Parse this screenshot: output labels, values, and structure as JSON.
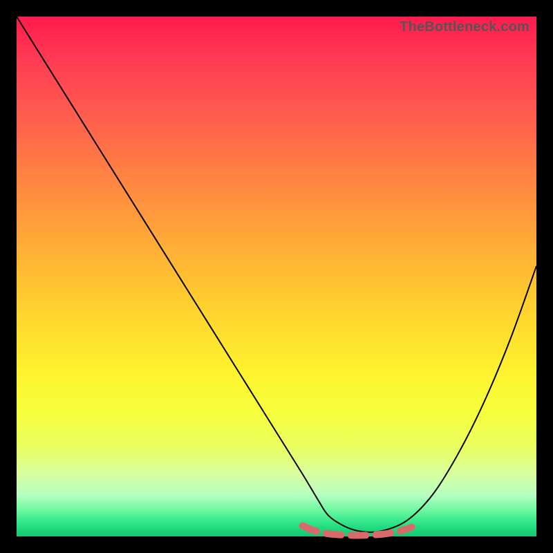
{
  "watermark": "TheBottleneck.com",
  "colors": {
    "background": "#000000",
    "curve": "#000000",
    "dash": "#d86a6a"
  },
  "chart_data": {
    "type": "line",
    "title": "",
    "xlabel": "",
    "ylabel": "",
    "xlim": [
      0,
      100
    ],
    "ylim": [
      0,
      100
    ],
    "grid": false,
    "series": [
      {
        "name": "bottleneck-curve",
        "x": [
          0,
          5,
          10,
          15,
          20,
          25,
          30,
          35,
          40,
          45,
          50,
          55,
          58,
          60,
          63,
          66,
          70,
          75,
          80,
          85,
          90,
          95,
          100
        ],
        "y": [
          100,
          92,
          84,
          76,
          68,
          60,
          52,
          44,
          36,
          28,
          20,
          12,
          7,
          4,
          2,
          1,
          1,
          3,
          8,
          16,
          26,
          38,
          52
        ]
      }
    ],
    "annotations": [
      {
        "name": "optimal-range-marker",
        "type": "dashed-segment",
        "x_start": 55,
        "x_end": 76,
        "y": 1
      }
    ]
  }
}
